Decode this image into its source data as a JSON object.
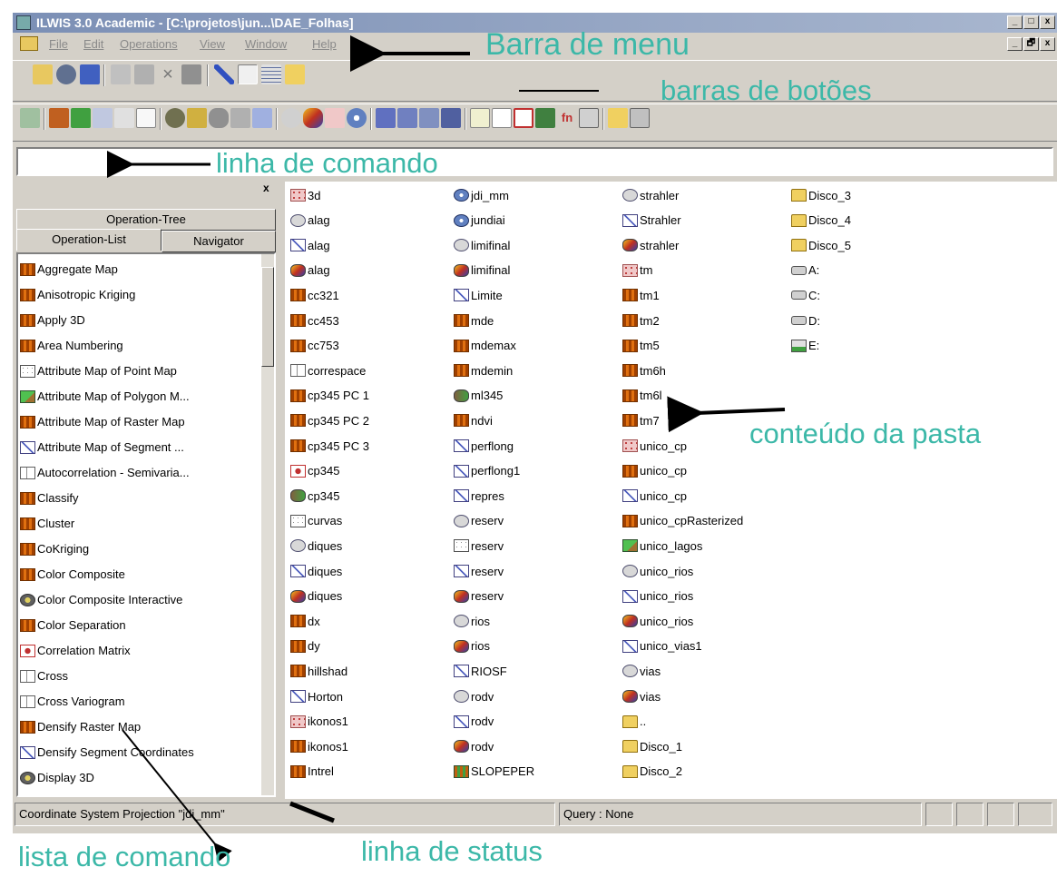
{
  "window": {
    "title": "ILWIS 3.0 Academic - [C:\\projetos\\jun...\\DAE_Folhas]",
    "window_buttons": [
      "_",
      "□",
      "x"
    ],
    "mdi_buttons": [
      "_",
      "🗗",
      "x"
    ]
  },
  "menu": [
    "File",
    "Edit",
    "Operations",
    "View",
    "Window",
    "Help"
  ],
  "left_panel": {
    "close": "x",
    "tabs": {
      "operation_tree": "Operation-Tree",
      "operation_list": "Operation-List",
      "navigator": "Navigator"
    },
    "operations": [
      {
        "label": "Aggregate Map",
        "icon": "raster-map-icon"
      },
      {
        "label": "Anisotropic Kriging",
        "icon": "raster-map-icon"
      },
      {
        "label": "Apply 3D",
        "icon": "raster-map-icon"
      },
      {
        "label": "Area Numbering",
        "icon": "raster-map-icon"
      },
      {
        "label": "Attribute Map of Point Map",
        "icon": "point-map-icon"
      },
      {
        "label": "Attribute Map of Polygon M...",
        "icon": "polygon-raster-icon"
      },
      {
        "label": "Attribute Map of Raster Map",
        "icon": "raster-map-icon"
      },
      {
        "label": "Attribute Map of Segment ...",
        "icon": "segment-map-icon"
      },
      {
        "label": "Autocorrelation - Semivaria...",
        "icon": "table-icon"
      },
      {
        "label": "Classify",
        "icon": "raster-map-icon"
      },
      {
        "label": "Cluster",
        "icon": "raster-map-icon"
      },
      {
        "label": "CoKriging",
        "icon": "raster-map-icon"
      },
      {
        "label": "Color Composite",
        "icon": "raster-map-icon"
      },
      {
        "label": "Color Composite Interactive",
        "icon": "display-icon"
      },
      {
        "label": "Color Separation",
        "icon": "raster-map-icon"
      },
      {
        "label": "Correlation Matrix",
        "icon": "matrix-icon"
      },
      {
        "label": "Cross",
        "icon": "table-icon"
      },
      {
        "label": "Cross Variogram",
        "icon": "table-icon"
      },
      {
        "label": "Densify Raster Map",
        "icon": "raster-map-icon"
      },
      {
        "label": "Densify Segment Coordinates",
        "icon": "segment-map-icon"
      },
      {
        "label": "Display 3D",
        "icon": "display-icon"
      }
    ]
  },
  "catalog": {
    "columns": [
      [
        {
          "label": "3d",
          "icon": "georef-icon"
        },
        {
          "label": "alag",
          "icon": "polygon-map-icon"
        },
        {
          "label": "alag",
          "icon": "segment-map-icon"
        },
        {
          "label": "alag",
          "icon": "representation-icon"
        },
        {
          "label": "cc321",
          "icon": "raster-map-icon"
        },
        {
          "label": "cc453",
          "icon": "raster-map-icon"
        },
        {
          "label": "cc753",
          "icon": "raster-map-icon"
        },
        {
          "label": "correspace",
          "icon": "table-icon"
        },
        {
          "label": "cp345 PC 1",
          "icon": "raster-map-icon"
        },
        {
          "label": "cp345 PC 2",
          "icon": "raster-map-icon"
        },
        {
          "label": "cp345 PC 3",
          "icon": "raster-map-icon"
        },
        {
          "label": "cp345",
          "icon": "matrix-icon"
        },
        {
          "label": "cp345",
          "icon": "map-list-icon"
        },
        {
          "label": "curvas",
          "icon": "point-map-icon"
        },
        {
          "label": "diques",
          "icon": "polygon-map-icon"
        },
        {
          "label": "diques",
          "icon": "segment-map-icon"
        },
        {
          "label": "diques",
          "icon": "representation-icon"
        },
        {
          "label": "dx",
          "icon": "raster-map-icon"
        },
        {
          "label": "dy",
          "icon": "raster-map-icon"
        },
        {
          "label": "hillshad",
          "icon": "raster-map-icon"
        },
        {
          "label": "Horton",
          "icon": "segment-map-icon"
        },
        {
          "label": "ikonos1",
          "icon": "georef-icon"
        },
        {
          "label": "ikonos1",
          "icon": "raster-map-icon"
        },
        {
          "label": "Intrel",
          "icon": "raster-map-icon"
        }
      ],
      [
        {
          "label": "jdi_mm",
          "icon": "coordsys-icon"
        },
        {
          "label": "jundiai",
          "icon": "coordsys-icon"
        },
        {
          "label": "limifinal",
          "icon": "polygon-map-icon"
        },
        {
          "label": "limifinal",
          "icon": "representation-icon"
        },
        {
          "label": "Limite",
          "icon": "segment-map-icon"
        },
        {
          "label": "mde",
          "icon": "raster-map-icon"
        },
        {
          "label": "mdemax",
          "icon": "raster-map-icon"
        },
        {
          "label": "mdemin",
          "icon": "raster-map-icon"
        },
        {
          "label": "ml345",
          "icon": "map-list-icon"
        },
        {
          "label": "ndvi",
          "icon": "raster-map-icon"
        },
        {
          "label": "perflong",
          "icon": "segment-map-icon"
        },
        {
          "label": "perflong1",
          "icon": "segment-map-icon"
        },
        {
          "label": "repres",
          "icon": "segment-map-icon"
        },
        {
          "label": "reserv",
          "icon": "polygon-map-icon"
        },
        {
          "label": "reserv",
          "icon": "point-map-icon"
        },
        {
          "label": "reserv",
          "icon": "segment-map-icon"
        },
        {
          "label": "reserv",
          "icon": "representation-icon"
        },
        {
          "label": "rios",
          "icon": "polygon-map-icon"
        },
        {
          "label": "rios",
          "icon": "representation-icon"
        },
        {
          "label": "RIOSF",
          "icon": "segment-map-icon"
        },
        {
          "label": "rodv",
          "icon": "polygon-map-icon"
        },
        {
          "label": "rodv",
          "icon": "segment-map-icon"
        },
        {
          "label": "rodv",
          "icon": "representation-icon"
        },
        {
          "label": "SLOPEPER",
          "icon": "slope-map-icon"
        }
      ],
      [
        {
          "label": "strahler",
          "icon": "polygon-map-icon"
        },
        {
          "label": "Strahler",
          "icon": "segment-map-icon"
        },
        {
          "label": "strahler",
          "icon": "representation-icon"
        },
        {
          "label": "tm",
          "icon": "georef-icon"
        },
        {
          "label": "tm1",
          "icon": "raster-map-icon"
        },
        {
          "label": "tm2",
          "icon": "raster-map-icon"
        },
        {
          "label": "tm5",
          "icon": "raster-map-icon"
        },
        {
          "label": "tm6h",
          "icon": "raster-map-icon"
        },
        {
          "label": "tm6l",
          "icon": "raster-map-icon"
        },
        {
          "label": "tm7",
          "icon": "raster-map-icon"
        },
        {
          "label": "unico_cp",
          "icon": "georef-icon"
        },
        {
          "label": "unico_cp",
          "icon": "raster-map-icon"
        },
        {
          "label": "unico_cp",
          "icon": "segment-map-icon"
        },
        {
          "label": "unico_cpRasterized",
          "icon": "raster-map-icon"
        },
        {
          "label": "unico_lagos",
          "icon": "polygon-raster-icon"
        },
        {
          "label": "unico_rios",
          "icon": "polygon-map-icon"
        },
        {
          "label": "unico_rios",
          "icon": "segment-map-icon"
        },
        {
          "label": "unico_rios",
          "icon": "representation-icon"
        },
        {
          "label": "unico_vias1",
          "icon": "segment-map-icon"
        },
        {
          "label": "vias",
          "icon": "polygon-map-icon"
        },
        {
          "label": "vias",
          "icon": "representation-icon"
        },
        {
          "label": "..",
          "icon": "folder-icon"
        },
        {
          "label": "Disco_1",
          "icon": "folder-icon"
        },
        {
          "label": "Disco_2",
          "icon": "folder-icon"
        }
      ],
      [
        {
          "label": "Disco_3",
          "icon": "folder-icon"
        },
        {
          "label": "Disco_4",
          "icon": "folder-icon"
        },
        {
          "label": "Disco_5",
          "icon": "folder-icon"
        },
        {
          "label": "A:",
          "icon": "drive-icon"
        },
        {
          "label": "C:",
          "icon": "drive-icon"
        },
        {
          "label": "D:",
          "icon": "drive-icon"
        },
        {
          "label": "E:",
          "icon": "network-drive-icon"
        }
      ]
    ]
  },
  "status": {
    "coordinate": "Coordinate System Projection \"jdi_mm\"",
    "query": "Query : None"
  },
  "annotations": {
    "menu_bar": "Barra de menu",
    "button_bars": "barras de botões",
    "command_line": "linha de comando",
    "folder_content": "conteúdo da pasta",
    "command_list": "lista de comando",
    "status_line": "linha de status"
  },
  "colors": {
    "annotation": "#3cb8a8",
    "window_face": "#d4d0c8",
    "title_bar": "#7b8fb5"
  }
}
